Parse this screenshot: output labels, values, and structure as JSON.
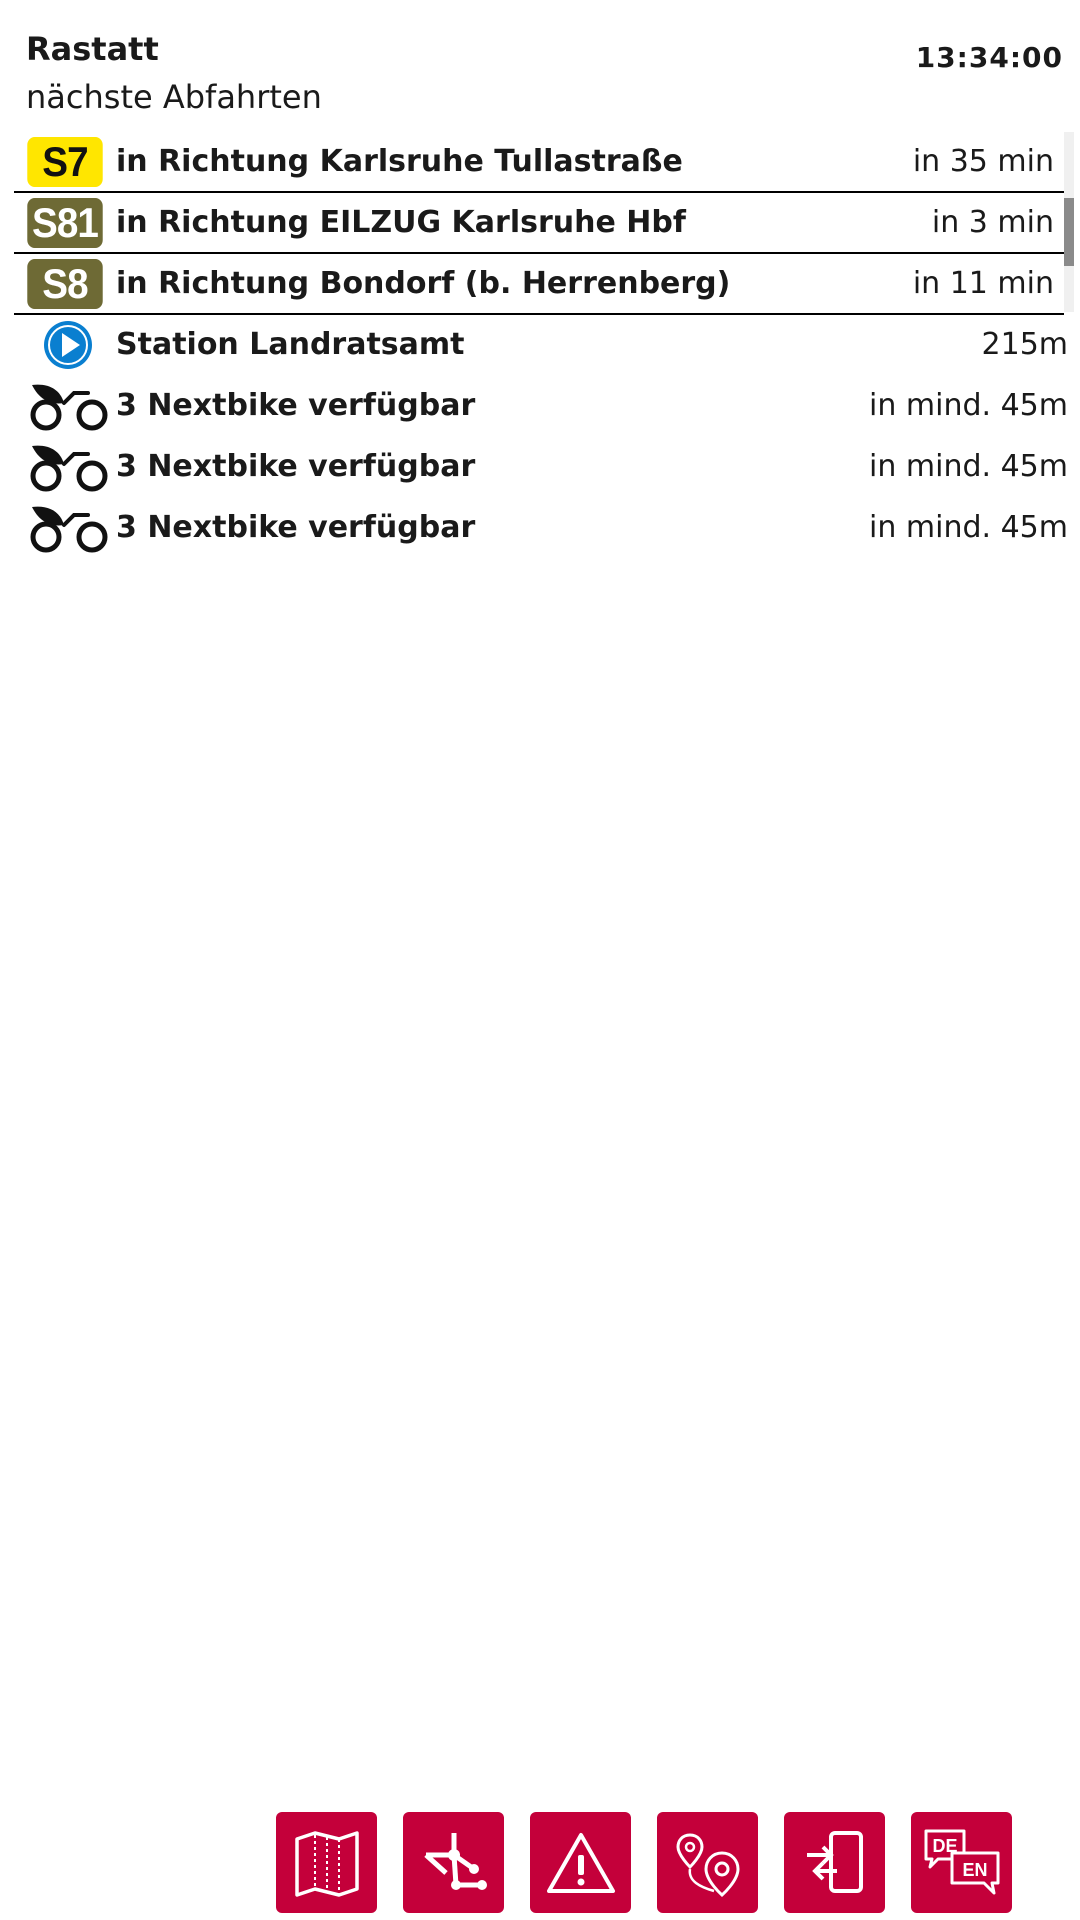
{
  "header": {
    "station": "Rastatt",
    "subtitle": "nächste Abfahrten",
    "clock": "13:34:00"
  },
  "departures": [
    {
      "line": "S7",
      "badge_bg": "#ffe600",
      "badge_fg": "#111111",
      "text": "in Richtung Karlsruhe Tullastraße",
      "time": "in 35 min"
    },
    {
      "line": "S81",
      "badge_bg": "#6e6a35",
      "badge_fg": "#ffffff",
      "text": "in Richtung EILZUG Karlsruhe Hbf",
      "time": "in 3 min"
    },
    {
      "line": "S8",
      "badge_bg": "#6e6a35",
      "badge_fg": "#ffffff",
      "text": "in Richtung Bondorf (b. Herrenberg)",
      "time": "in 11 min"
    }
  ],
  "pois": [
    {
      "icon": "station-play-icon",
      "text": "Station Landratsamt",
      "distance": "215m"
    },
    {
      "icon": "nextbike-icon",
      "text": "3 Nextbike verfügbar",
      "distance": "in mind. 45m"
    },
    {
      "icon": "nextbike-icon",
      "text": "3 Nextbike verfügbar",
      "distance": "in mind. 45m"
    },
    {
      "icon": "nextbike-icon",
      "text": "3 Nextbike verfügbar",
      "distance": "in mind. 45m"
    }
  ],
  "toolbar": {
    "accent": "#c4003a",
    "buttons": [
      {
        "icon": "map-icon"
      },
      {
        "icon": "network-icon"
      },
      {
        "icon": "warning-icon"
      },
      {
        "icon": "route-icon"
      },
      {
        "icon": "exit-phone-icon"
      },
      {
        "icon": "language-icon",
        "label_de": "DE",
        "label_en": "EN"
      }
    ]
  },
  "colors": {
    "accent": "#c4003a",
    "station_blue": "#0a7fd0"
  }
}
